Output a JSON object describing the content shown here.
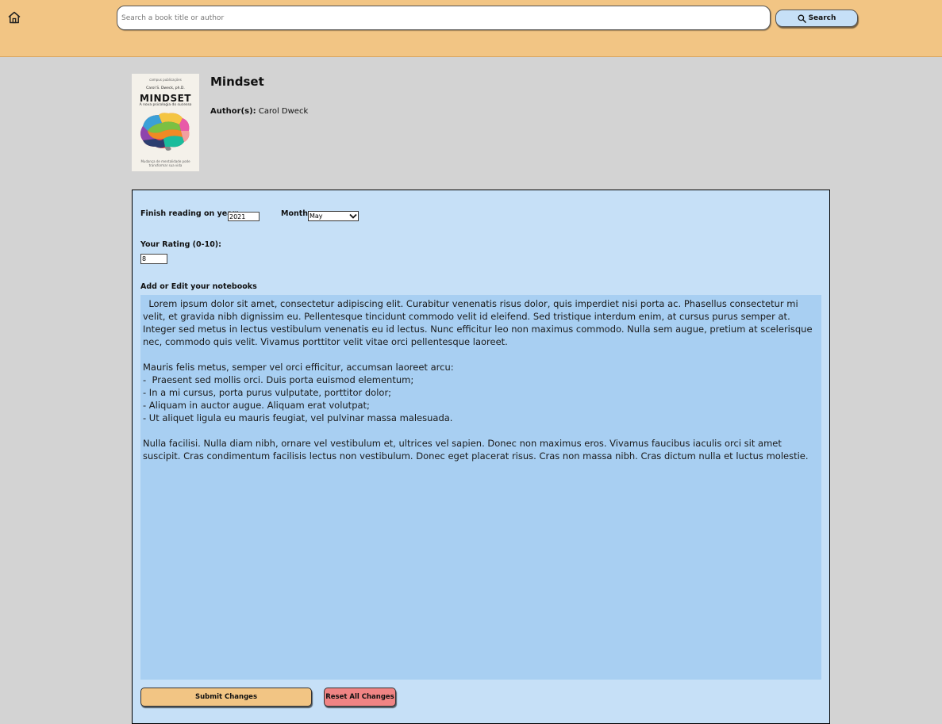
{
  "header": {
    "search_placeholder": "Search a book title or author",
    "search_button_label": "Search"
  },
  "book": {
    "title": "Mindset",
    "author_label": "Author(s):",
    "author": "Carol Dweck",
    "cover": {
      "top_text": "campus publicações",
      "author": "Carol S. Dweck, ph.D.",
      "title": "MINDSET",
      "subtitle": "A nova psicologia do sucesso",
      "bottom_text": "Mudança de mentalidade pode transformar sua vida"
    }
  },
  "form": {
    "year_label": "Finish reading on year:",
    "year_value": "2021",
    "month_label": "Month",
    "month_value": "May",
    "rating_label": "Your Rating (0-10):",
    "rating_value": "8",
    "notes_label": "Add or Edit your notebooks",
    "notes_text": "  Lorem ipsum dolor sit amet, consectetur adipiscing elit. Curabitur venenatis risus dolor, quis imperdiet nisi porta ac. Phasellus consectetur mi velit, et gravida nibh dignissim eu. Pellentesque tincidunt commodo velit id eleifend. Sed tristique interdum enim, at cursus purus semper at. Integer sed metus in lectus vestibulum venenatis eu id lectus. Nunc efficitur leo non maximus commodo. Nulla sem augue, pretium at scelerisque nec, commodo quis velit. Vivamus porttitor velit vitae orci pellentesque laoreet.\n\nMauris felis metus, semper vel orci efficitur, accumsan laoreet arcu:\n-  Praesent sed mollis orci. Duis porta euismod elementum;\n- In a mi cursus, porta purus vulputate, porttitor dolor;\n- Aliquam in auctor augue. Aliquam erat volutpat;\n- Ut aliquet ligula eu mauris feugiat, vel pulvinar massa malesuada.\n\nNulla facilisi. Nulla diam nibh, ornare vel vestibulum et, ultrices vel sapien. Donec non maximus eros. Vivamus faucibus iaculis orci sit amet suscipit. Cras condimentum facilisis lectus non vestibulum. Donec eget placerat risus. Cras non massa nibh. Cras dictum nulla et luctus molestie.",
    "submit_label": "Submit Changes",
    "reset_label": "Reset All Changes"
  },
  "colors": {
    "header_bg": "#f2c584",
    "page_bg": "#d3d3d3",
    "panel_bg": "#c6e0f7",
    "notes_bg": "#a8cff2",
    "submit_bg": "#f2c584",
    "reset_bg": "#f08484"
  },
  "icons": {
    "home": "home-icon",
    "search": "magnifier-icon",
    "dropdown": "chevron-down-icon"
  }
}
